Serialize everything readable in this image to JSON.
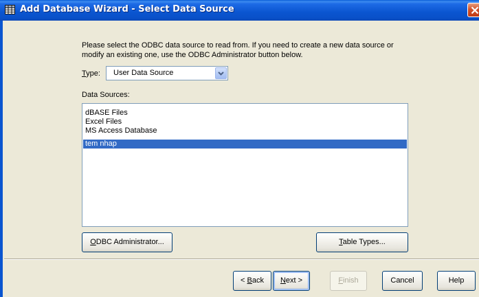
{
  "window": {
    "title": "Add Database Wizard - Select Data Source"
  },
  "intro_text": "Please select the ODBC data source to read from. If you need to create a new data source or modify an existing one, use the ODBC Administrator button below.",
  "type_field": {
    "label_prefix": "",
    "label_accel": "T",
    "label_rest": "ype:",
    "value": "User Data Source"
  },
  "data_sources": {
    "label": "Data Sources:",
    "items": [
      {
        "label": "dBASE Files",
        "selected": false
      },
      {
        "label": "Excel Files",
        "selected": false
      },
      {
        "label": "MS Access Database",
        "selected": false
      },
      {
        "label": "tem nhap",
        "selected": true
      }
    ]
  },
  "buttons": {
    "odbc_admin": {
      "accel": "O",
      "rest": "DBC Administrator..."
    },
    "table_types": {
      "accel": "T",
      "rest": "able Types..."
    },
    "back": {
      "prefix": "< ",
      "accel": "B",
      "rest": "ack"
    },
    "next": {
      "accel": "N",
      "rest": "ext >"
    },
    "finish": {
      "accel": "F",
      "rest": "inish"
    },
    "cancel": {
      "label": "Cancel"
    },
    "help": {
      "label": "Help"
    }
  },
  "colors": {
    "title_bar": "#0a55d0",
    "selection": "#316ac5",
    "dialog_bg": "#ece9d8"
  },
  "icons": {
    "title": "grid-icon",
    "close": "close-icon",
    "dropdown": "chevron-down-icon"
  }
}
